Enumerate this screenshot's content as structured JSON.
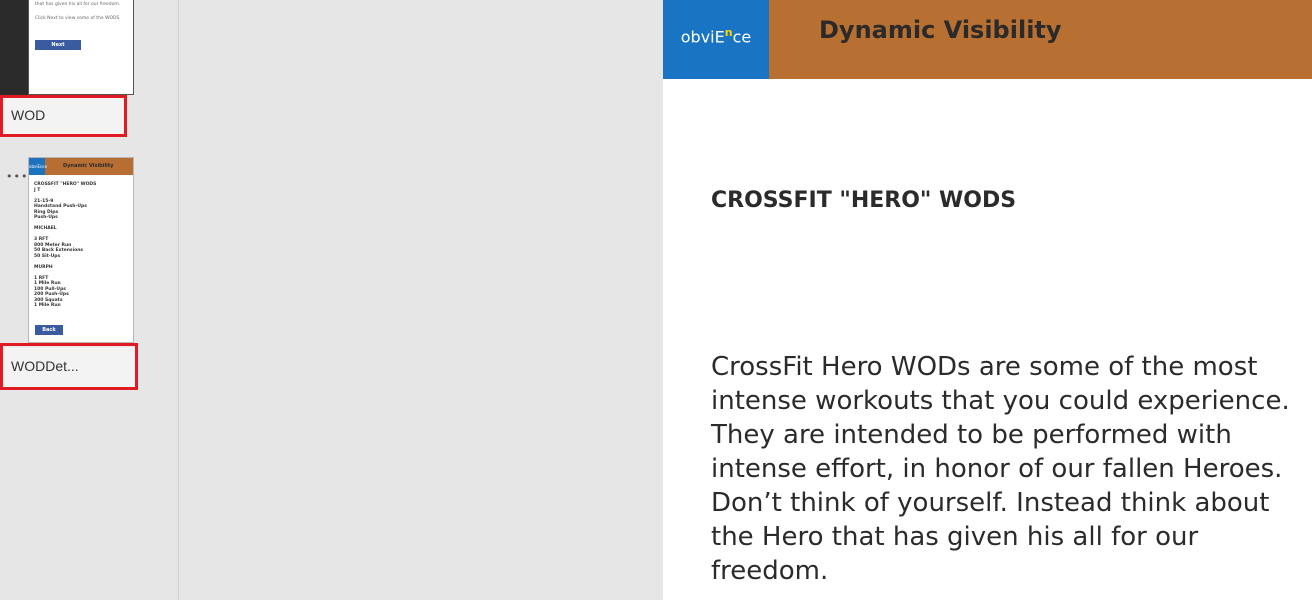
{
  "screens": {
    "screen1": {
      "label": "WOD",
      "thumbnail": {
        "line1": "that has given his all for our freedom.",
        "line2": "Click Next to view some of the WODS",
        "button": "Next"
      }
    },
    "screen2": {
      "label": "WODDet...",
      "thumbnail": {
        "logo": "obviEnce",
        "title": "Dynamic Visibility",
        "text": "CROSSFIT \"HERO\" WODS\nJ T\n\n21-15-9\nHandstand Push-Ups\nRing Dips\nPush-Ups\n\nMICHAEL\n\n3 RFT\n800 Meter Run\n50 Back Extensions\n50 Sit-Ups\n\nMURPH\n\n1 RFT\n1 Mile Run\n100 Pull-Ups\n200 Push-Ups\n300 Squats\n1 Mile Run",
        "button": "Back"
      }
    },
    "more_options": "•••"
  },
  "preview": {
    "logo_prefix": "obviE",
    "logo_sup": "n",
    "logo_suffix": "ce",
    "app_title": "Dynamic Visibility",
    "heading": "CROSSFIT \"HERO\" WODS",
    "body": "CrossFit Hero WODs are some of the most intense workouts that you could experience. They are intended to be performed with intense effort, in honor of our fallen Heroes. Don’t think of yourself. Instead think about the Hero that has given his all for our freedom."
  },
  "colors": {
    "header": "#b86f32",
    "logo_bg": "#1a74c4",
    "highlight": "#e01b24",
    "button": "#3a5ba0"
  }
}
